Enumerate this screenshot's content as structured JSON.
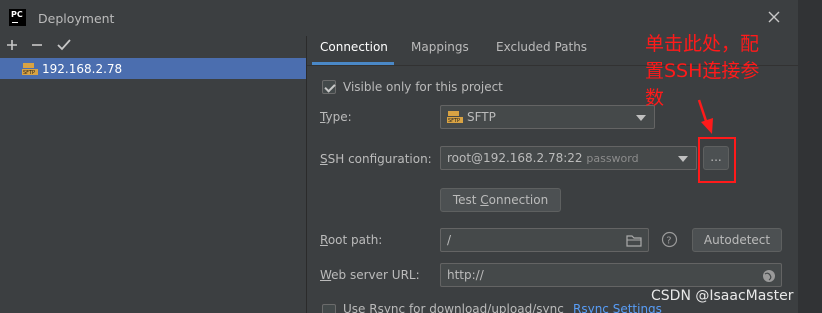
{
  "window": {
    "title": "Deployment",
    "app_icon_text": "PC"
  },
  "toolbar": {
    "add": "+",
    "remove": "−",
    "apply": "✓"
  },
  "servers": [
    {
      "label": "192.168.2.78",
      "icon": "sftp-icon",
      "selected": true
    }
  ],
  "tabs": [
    {
      "label": "Connection",
      "active": true
    },
    {
      "label": "Mappings",
      "active": false
    },
    {
      "label": "Excluded Paths",
      "active": false
    }
  ],
  "form": {
    "visible_only_label": "Visible only for this project",
    "visible_only_checked": true,
    "type_label_u": "T",
    "type_label_rest": "ype:",
    "type_value": "SFTP",
    "ssh_label_u": "S",
    "ssh_label_rest": "SH configuration:",
    "ssh_value": "root@192.168.2.78:22",
    "ssh_hint": "password",
    "ssh_more_button": "...",
    "test_connection_pre": "Test ",
    "test_connection_u": "C",
    "test_connection_post": "onnection",
    "root_path_label_u": "R",
    "root_path_label_rest": "oot path:",
    "root_path_value": "/",
    "autodetect_button": "Autodetect",
    "web_url_label_u": "W",
    "web_url_label_rest": "eb server URL:",
    "web_url_value": "http://",
    "rsync_label": "Use Rsync for download/upload/sync",
    "rsync_checked": false,
    "rsync_settings_link": "Rsync Settings"
  },
  "annotation": {
    "text_line1": "单击此处，配",
    "text_line2": "置SSH连接参",
    "text_line3": "数",
    "color": "#ff1a1a"
  },
  "watermark": "CSDN @IsaacMaster",
  "colors": {
    "accent": "#4a88c7",
    "selection": "#4b6eaf",
    "link": "#589df6",
    "background": "#3c3f41"
  }
}
